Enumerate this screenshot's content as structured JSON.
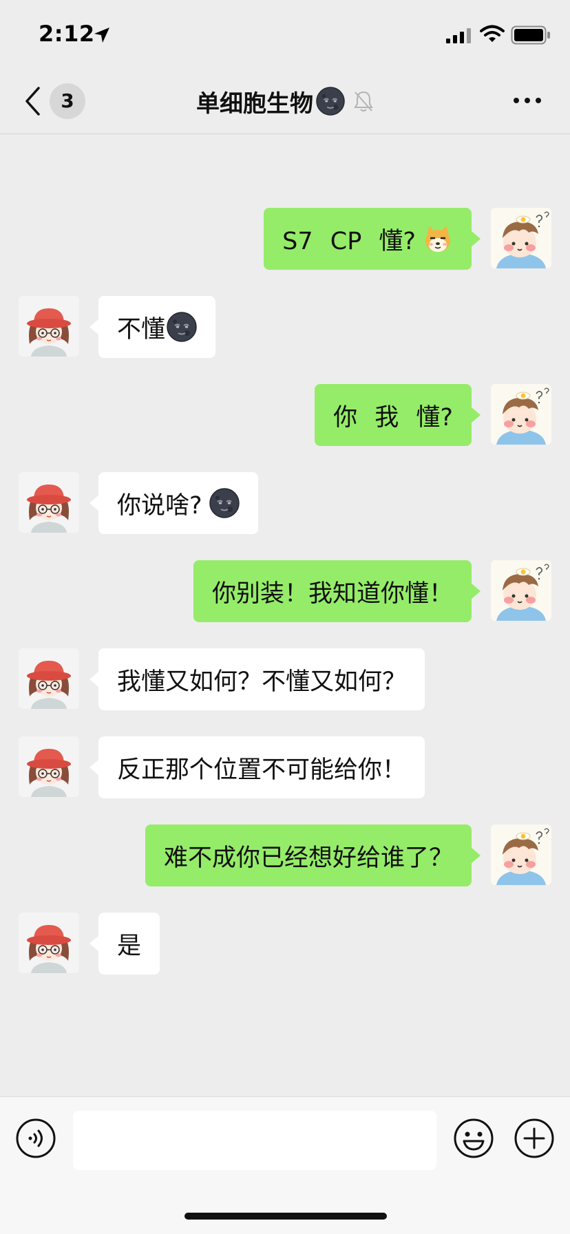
{
  "status_bar": {
    "time": "2:12"
  },
  "nav": {
    "back_count": "3",
    "title": "单细胞生物",
    "title_emoji": "new-moon-face-emoji",
    "icons": [
      "chevron-left-icon",
      "bell-muted-icon",
      "more-dots-icon"
    ]
  },
  "messages": [
    {
      "sender": "me",
      "text": "S7  CP  懂?",
      "emoji": "doge-cat-emoji"
    },
    {
      "sender": "them",
      "text": "不懂",
      "emoji": "new-moon-face-emoji"
    },
    {
      "sender": "me",
      "text": "你  我  懂?"
    },
    {
      "sender": "them",
      "text": "你说啥? ",
      "emoji": "new-moon-face-emoji"
    },
    {
      "sender": "me",
      "text": "你别装！我知道你懂！"
    },
    {
      "sender": "them",
      "text": "我懂又如何？不懂又如何？"
    },
    {
      "sender": "them",
      "text": "反正那个位置不可能给你！"
    },
    {
      "sender": "me",
      "text": "难不成你已经想好给谁了？"
    },
    {
      "sender": "them",
      "text": "是"
    }
  ],
  "input": {
    "value": "",
    "placeholder": ""
  },
  "colors": {
    "background": "#ededed",
    "my_bubble": "#95ec69",
    "their_bubble": "#ffffff",
    "input_bar": "#f7f7f7"
  }
}
